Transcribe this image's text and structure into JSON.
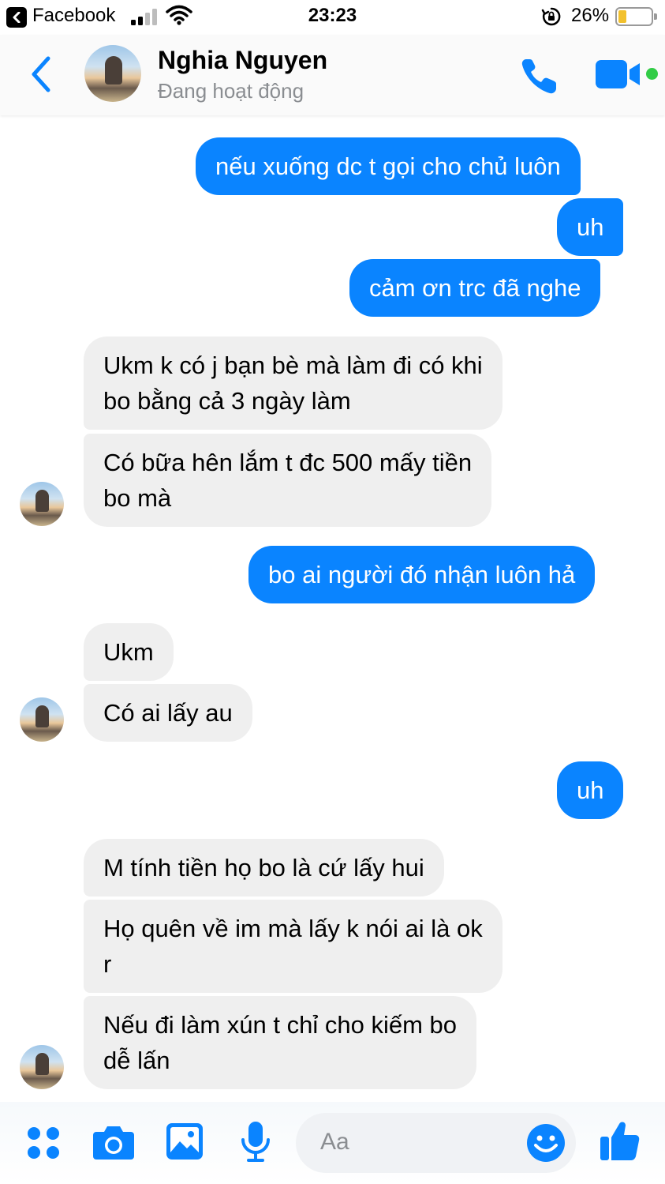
{
  "status_bar": {
    "app": "Facebook",
    "time": "23:23",
    "battery": "26%",
    "battery_level": 0.26
  },
  "header": {
    "name": "Nghia Nguyen",
    "status": "Đang hoạt động"
  },
  "messages": [
    {
      "dir": "out",
      "text": "nếu xuống dc t gọi cho chủ luôn"
    },
    {
      "dir": "out",
      "text": "uh"
    },
    {
      "dir": "out",
      "text": "cảm ơn trc đã nghe"
    },
    {
      "dir": "in",
      "line1": "Ukm k có j bạn bè mà làm đi có khi",
      "line2": "bo bằng cả 3 ngày làm"
    },
    {
      "dir": "in",
      "line1": "Có bữa hên lắm t đc 500 mấy tiền",
      "line2": "bo mà"
    },
    {
      "dir": "out",
      "text": "bo ai người đó nhận luôn hả"
    },
    {
      "dir": "in",
      "text": "Ukm"
    },
    {
      "dir": "in",
      "text": "Có ai lấy au"
    },
    {
      "dir": "out",
      "text": "uh"
    },
    {
      "dir": "in",
      "text": "M tính tiền họ bo là cứ lấy hui"
    },
    {
      "dir": "in",
      "line1": "Họ quên về im mà lấy k nói ai là ok",
      "line2": "r"
    },
    {
      "dir": "in",
      "line1": "Nếu đi làm xún t chỉ cho kiếm bo",
      "line2": "dễ lấn"
    }
  ],
  "composer": {
    "placeholder": "Aa",
    "icons": [
      "apps-icon",
      "camera-icon",
      "gallery-icon",
      "microphone-icon",
      "emoji-icon",
      "thumbs-up-icon"
    ]
  },
  "colors": {
    "accent": "#0a84ff",
    "incoming_bubble": "#efefef",
    "online": "#31cc46"
  }
}
